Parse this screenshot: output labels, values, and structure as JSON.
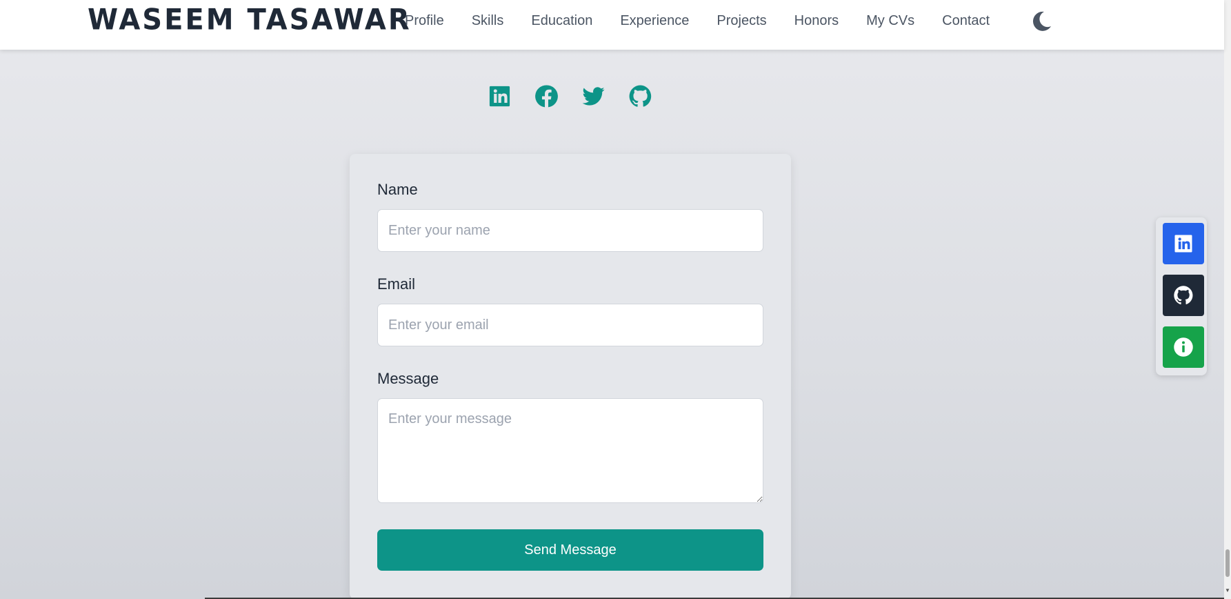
{
  "header": {
    "brand": "WASEEM TASAWAR",
    "nav": [
      "Profile",
      "Skills",
      "Education",
      "Experience",
      "Projects",
      "Honors",
      "My CVs",
      "Contact"
    ],
    "theme_toggle_icon": "moon-icon"
  },
  "social_links": [
    {
      "icon": "linkedin-icon"
    },
    {
      "icon": "facebook-icon"
    },
    {
      "icon": "twitter-icon"
    },
    {
      "icon": "github-icon"
    }
  ],
  "form": {
    "name_label": "Name",
    "name_placeholder": "Enter your name",
    "name_value": "",
    "email_label": "Email",
    "email_placeholder": "Enter your email",
    "email_value": "",
    "message_label": "Message",
    "message_placeholder": "Enter your message",
    "message_value": "",
    "submit_label": "Send Message"
  },
  "side_panel": [
    {
      "icon": "linkedin-icon",
      "color": "#2563eb"
    },
    {
      "icon": "github-icon",
      "color": "#1f2937"
    },
    {
      "icon": "info-icon",
      "color": "#16a34a"
    }
  ],
  "colors": {
    "accent": "#0d9488",
    "card_bg": "#e5e7eb",
    "text_dark": "#1f2937"
  }
}
